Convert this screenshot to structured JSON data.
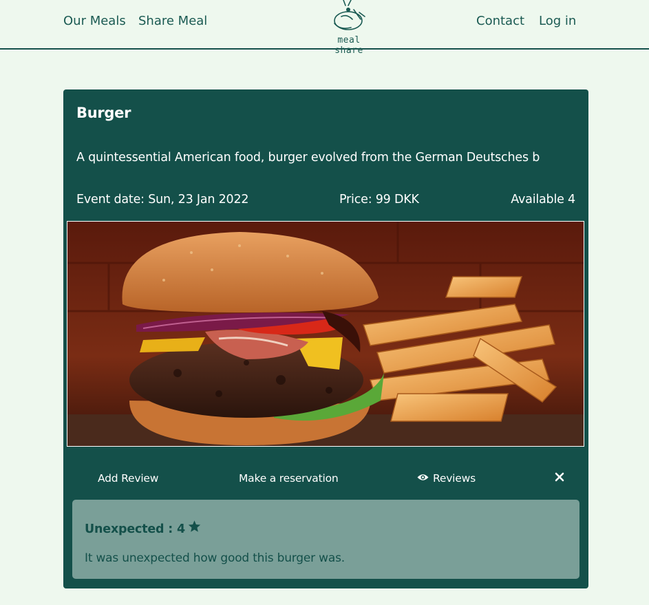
{
  "nav": {
    "left": [
      "Our Meals",
      "Share Meal"
    ],
    "right": [
      "Contact",
      "Log in"
    ],
    "logo_text": "meal share"
  },
  "meal": {
    "title": "Burger",
    "description": "A quintessential American food, burger evolved from the German Deutsches b",
    "event_date": "Event date: Sun, 23 Jan 2022",
    "price": "Price: 99 DKK",
    "available": "Available 4",
    "image_icon": "burger-photo"
  },
  "actions": {
    "add_review": "Add Review",
    "make_reservation": "Make a reservation",
    "reviews": "Reviews",
    "close_icon": "close-icon"
  },
  "review": {
    "title": "Unexpected : 4",
    "rating": 4,
    "text": "It was unexpected how good this burger was."
  },
  "colors": {
    "primary": "#14504a",
    "background": "#eef8ee",
    "review_bg": "#7a9f98"
  }
}
